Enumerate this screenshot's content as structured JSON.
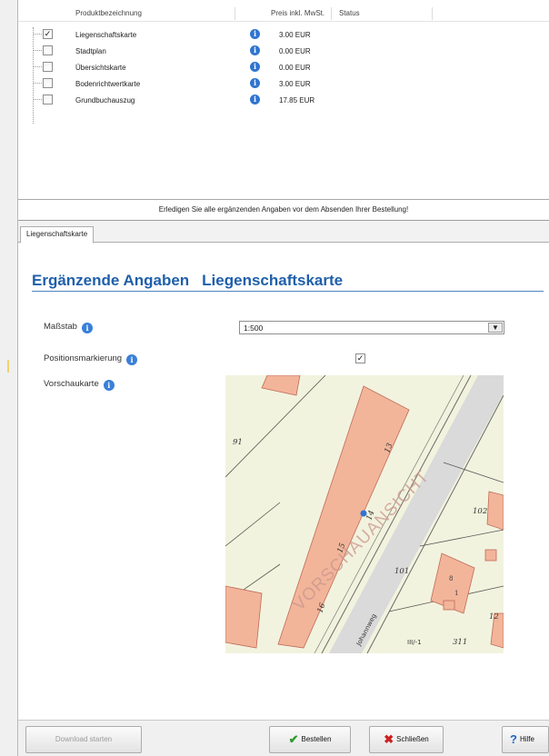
{
  "products": {
    "headers": {
      "name": "Produktbezeichnung",
      "price": "Preis inkl. MwSt.",
      "status": "Status"
    },
    "rows": [
      {
        "checked": true,
        "name": "Liegenschaftskarte",
        "price": "3.00 EUR"
      },
      {
        "checked": false,
        "name": "Stadtplan",
        "price": "0.00 EUR"
      },
      {
        "checked": false,
        "name": "Übersichtskarte",
        "price": "0.00 EUR"
      },
      {
        "checked": false,
        "name": "Bodenrichtwertkarte",
        "price": "3.00 EUR"
      },
      {
        "checked": false,
        "name": "Grundbuchauszug",
        "price": "17.85 EUR"
      }
    ],
    "info_icon": "i"
  },
  "message": "Erledigen Sie alle ergänzenden Angaben vor dem Absenden Ihrer Bestellung!",
  "detail": {
    "tab": "Liegenschaftskarte",
    "title_prefix": "Ergänzende Angaben",
    "title_product": "Liegenschaftskarte",
    "fields": {
      "massstab_label": "Maßstab",
      "massstab_value": "1:500",
      "position_label": "Positionsmarkierung",
      "position_checked": true,
      "preview_label": "Vorschaukarte"
    },
    "map": {
      "watermark": "VORSCHAUANSICHT",
      "street": "Johannweg",
      "parcels": [
        "91",
        "13",
        "14",
        "15",
        "16",
        "102",
        "101",
        "12",
        "311"
      ],
      "house_numbers": [
        "8",
        "1"
      ],
      "extra_label": "III/-1"
    }
  },
  "actions": {
    "download": "Download starten",
    "order": "Bestellen",
    "close": "Schließen",
    "help": "Hilfe"
  }
}
